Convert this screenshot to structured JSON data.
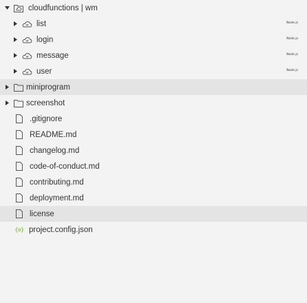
{
  "tree": {
    "root": {
      "label": "cloudfunctions | wm",
      "icon": "cloud-folder-icon",
      "expanded": true
    },
    "cloud_functions": [
      {
        "label": "list",
        "icon": "cloud-function-icon",
        "badge": "Node.js"
      },
      {
        "label": "login",
        "icon": "cloud-function-icon",
        "badge": "Node.js"
      },
      {
        "label": "message",
        "icon": "cloud-function-icon",
        "badge": "Node.js"
      },
      {
        "label": "user",
        "icon": "cloud-function-icon",
        "badge": "Node.js"
      }
    ],
    "folders": [
      {
        "label": "miniprogram",
        "icon": "folder-icon"
      },
      {
        "label": "screenshot",
        "icon": "folder-icon"
      }
    ],
    "files": [
      {
        "label": ".gitignore",
        "icon": "file-icon"
      },
      {
        "label": "README.md",
        "icon": "file-icon"
      },
      {
        "label": "changelog.md",
        "icon": "file-icon"
      },
      {
        "label": "code-of-conduct.md",
        "icon": "file-icon"
      },
      {
        "label": "contributing.md",
        "icon": "file-icon"
      },
      {
        "label": "deployment.md",
        "icon": "file-icon"
      },
      {
        "label": "license",
        "icon": "file-icon"
      }
    ],
    "config_file": {
      "label": "project.config.json",
      "icon": "json-braces-icon",
      "icon_glyph": "{o}"
    }
  },
  "colors": {
    "background": "#f3f3f3",
    "highlight": "#e4e4e4",
    "text": "#333333",
    "icon": "#555555",
    "json_icon": "#8cc152"
  }
}
